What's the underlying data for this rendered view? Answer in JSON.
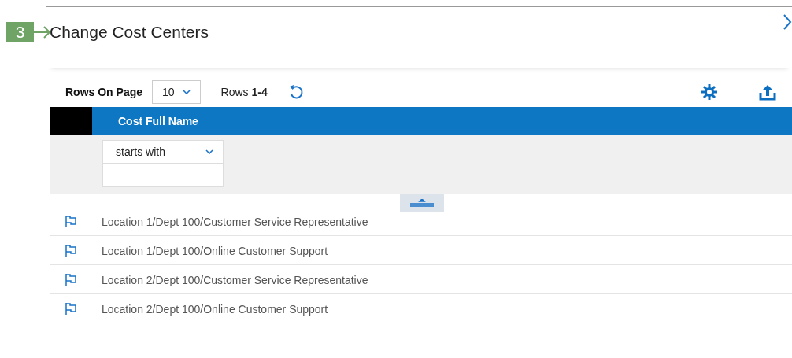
{
  "callout": {
    "number": "3"
  },
  "dialog": {
    "title": "Change Cost Centers"
  },
  "toolbar": {
    "rows_on_page_label": "Rows On Page",
    "rows_on_page_value": "10",
    "rows_prefix": "Rows",
    "rows_range": "1-4"
  },
  "table": {
    "columns": [
      "Cost Full Name"
    ],
    "filter": {
      "operator": "starts with"
    },
    "rows": [
      {
        "name": "Location 1/Dept 100/Customer Service Representative"
      },
      {
        "name": "Location 1/Dept 100/Online Customer Support"
      },
      {
        "name": "Location 2/Dept 100/Customer Service Representative"
      },
      {
        "name": "Location 2/Dept 100/Online Customer Support"
      }
    ]
  }
}
